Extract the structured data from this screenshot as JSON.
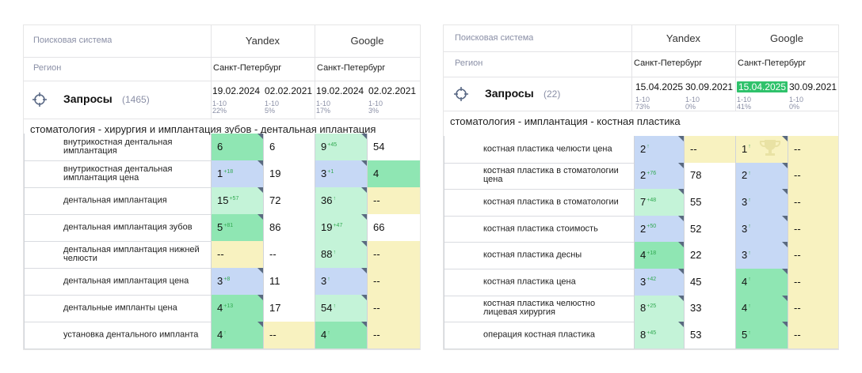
{
  "colors": {
    "green": "#8fe6b3",
    "light_green": "#c4f3d8",
    "blue": "#c6d8f5",
    "yellow": "#f8f2c0",
    "white": "#ffffff",
    "highlight": "#2fc26b"
  },
  "left": {
    "search_system_label": "Поисковая система",
    "region_label": "Регион",
    "engines": [
      "Yandex",
      "Google"
    ],
    "regions": [
      "Санкт-Петербург",
      "Санкт-Петербург"
    ],
    "queries_label": "Запросы",
    "queries_count": "(1465)",
    "dates": [
      {
        "date": "19.02.2024",
        "range": "1-10",
        "pct": "22%"
      },
      {
        "date": "02.02.2021",
        "range": "1-10",
        "pct": "5%"
      },
      {
        "date": "19.02.2024",
        "range": "1-10",
        "pct": "17%"
      },
      {
        "date": "02.02.2021",
        "range": "1-10",
        "pct": "3%"
      }
    ],
    "section_title": "стоматология - хирургия и имплантация зубов - дентальная иплантация",
    "rows": [
      {
        "kw": "внутрикостная дентальная имплантация",
        "cells": [
          {
            "v": "6",
            "s": "",
            "c": "green",
            "t": true
          },
          {
            "v": "6",
            "s": "",
            "c": "white",
            "t": false
          },
          {
            "v": "9",
            "s": "+45",
            "c": "light_green",
            "t": true
          },
          {
            "v": "54",
            "s": "",
            "c": "white",
            "t": false
          }
        ]
      },
      {
        "kw": "внутрикостная дентальная имплантация цена",
        "cells": [
          {
            "v": "1",
            "s": "+18",
            "c": "blue",
            "t": true
          },
          {
            "v": "19",
            "s": "",
            "c": "white",
            "t": false
          },
          {
            "v": "3",
            "s": "+1",
            "c": "blue",
            "t": true
          },
          {
            "v": "4",
            "s": "",
            "c": "green",
            "t": false
          }
        ]
      },
      {
        "kw": "дентальная имплантация",
        "cells": [
          {
            "v": "15",
            "s": "+57",
            "c": "light_green",
            "t": true
          },
          {
            "v": "72",
            "s": "",
            "c": "white",
            "t": false
          },
          {
            "v": "36",
            "s": "↑",
            "c": "light_green",
            "t": true
          },
          {
            "v": "--",
            "s": "",
            "c": "yellow",
            "t": false
          }
        ]
      },
      {
        "kw": "дентальная имплантация зубов",
        "cells": [
          {
            "v": "5",
            "s": "+81",
            "c": "green",
            "t": true
          },
          {
            "v": "86",
            "s": "",
            "c": "white",
            "t": false
          },
          {
            "v": "19",
            "s": "+47",
            "c": "light_green",
            "t": true
          },
          {
            "v": "66",
            "s": "",
            "c": "white",
            "t": false
          }
        ]
      },
      {
        "kw": "дентальная имплантация нижней челюсти",
        "cells": [
          {
            "v": "--",
            "s": "",
            "c": "yellow",
            "t": false
          },
          {
            "v": "--",
            "s": "",
            "c": "white",
            "t": false
          },
          {
            "v": "88",
            "s": "↑",
            "c": "light_green",
            "t": true
          },
          {
            "v": "--",
            "s": "",
            "c": "yellow",
            "t": false
          }
        ]
      },
      {
        "kw": "дентальная имплантация цена",
        "cells": [
          {
            "v": "3",
            "s": "+8",
            "c": "blue",
            "t": true
          },
          {
            "v": "11",
            "s": "",
            "c": "white",
            "t": false
          },
          {
            "v": "3",
            "s": "↑",
            "c": "blue",
            "t": true
          },
          {
            "v": "--",
            "s": "",
            "c": "yellow",
            "t": false
          }
        ]
      },
      {
        "kw": "дентальные импланты цена",
        "cells": [
          {
            "v": "4",
            "s": "+13",
            "c": "green",
            "t": true
          },
          {
            "v": "17",
            "s": "",
            "c": "white",
            "t": false
          },
          {
            "v": "54",
            "s": "↑",
            "c": "light_green",
            "t": true
          },
          {
            "v": "--",
            "s": "",
            "c": "yellow",
            "t": false
          }
        ]
      },
      {
        "kw": "установка дентального импланта",
        "cells": [
          {
            "v": "4",
            "s": "↑",
            "c": "green",
            "t": true
          },
          {
            "v": "--",
            "s": "",
            "c": "yellow",
            "t": false
          },
          {
            "v": "4",
            "s": "↑",
            "c": "green",
            "t": true
          },
          {
            "v": "--",
            "s": "",
            "c": "yellow",
            "t": false
          }
        ]
      }
    ]
  },
  "right": {
    "search_system_label": "Поисковая система",
    "region_label": "Регион",
    "engines": [
      "Yandex",
      "Google"
    ],
    "regions": [
      "Санкт-Петербург",
      "Санкт-Петербург"
    ],
    "queries_label": "Запросы",
    "queries_count": "(22)",
    "dates": [
      {
        "date": "15.04.2025",
        "range": "1-10",
        "pct": "73%",
        "hl": false
      },
      {
        "date": "30.09.2021",
        "range": "1-10",
        "pct": "0%",
        "hl": false
      },
      {
        "date": "15.04.2025",
        "range": "1-10",
        "pct": "41%",
        "hl": true
      },
      {
        "date": "30.09.2021",
        "range": "1-10",
        "pct": "0%",
        "hl": false
      }
    ],
    "section_title": "стоматология - имплантация - костная пластика",
    "rows": [
      {
        "kw": "костная пластика челюсти цена",
        "cells": [
          {
            "v": "2",
            "s": "↑",
            "c": "blue",
            "t": true
          },
          {
            "v": "--",
            "s": "",
            "c": "yellow",
            "t": false
          },
          {
            "v": "1",
            "s": "↑",
            "c": "yellow",
            "t": true,
            "trophy": true
          },
          {
            "v": "--",
            "s": "",
            "c": "yellow",
            "t": false
          }
        ]
      },
      {
        "kw": "костная пластика в стоматологии цена",
        "cells": [
          {
            "v": "2",
            "s": "+76",
            "c": "blue",
            "t": true
          },
          {
            "v": "78",
            "s": "",
            "c": "white",
            "t": false
          },
          {
            "v": "2",
            "s": "↑",
            "c": "blue",
            "t": true
          },
          {
            "v": "--",
            "s": "",
            "c": "yellow",
            "t": false
          }
        ]
      },
      {
        "kw": "костная пластика в стоматологии",
        "cells": [
          {
            "v": "7",
            "s": "+48",
            "c": "light_green",
            "t": true
          },
          {
            "v": "55",
            "s": "",
            "c": "white",
            "t": false
          },
          {
            "v": "3",
            "s": "↑",
            "c": "blue",
            "t": true
          },
          {
            "v": "--",
            "s": "",
            "c": "yellow",
            "t": false
          }
        ]
      },
      {
        "kw": "костная пластика стоимость",
        "cells": [
          {
            "v": "2",
            "s": "+50",
            "c": "blue",
            "t": true
          },
          {
            "v": "52",
            "s": "",
            "c": "white",
            "t": false
          },
          {
            "v": "3",
            "s": "↑",
            "c": "blue",
            "t": true
          },
          {
            "v": "--",
            "s": "",
            "c": "yellow",
            "t": false
          }
        ]
      },
      {
        "kw": "костная пластика десны",
        "cells": [
          {
            "v": "4",
            "s": "+18",
            "c": "green",
            "t": true
          },
          {
            "v": "22",
            "s": "",
            "c": "white",
            "t": false
          },
          {
            "v": "3",
            "s": "↑",
            "c": "blue",
            "t": true
          },
          {
            "v": "--",
            "s": "",
            "c": "yellow",
            "t": false
          }
        ]
      },
      {
        "kw": "костная пластика цена",
        "cells": [
          {
            "v": "3",
            "s": "+42",
            "c": "blue",
            "t": true
          },
          {
            "v": "45",
            "s": "",
            "c": "white",
            "t": false
          },
          {
            "v": "4",
            "s": "↑",
            "c": "green",
            "t": true
          },
          {
            "v": "--",
            "s": "",
            "c": "yellow",
            "t": false
          }
        ]
      },
      {
        "kw": "костная пластика челюстно лицевая хирургия",
        "cells": [
          {
            "v": "8",
            "s": "+25",
            "c": "light_green",
            "t": true
          },
          {
            "v": "33",
            "s": "",
            "c": "white",
            "t": false
          },
          {
            "v": "4",
            "s": "↑",
            "c": "green",
            "t": true
          },
          {
            "v": "--",
            "s": "",
            "c": "yellow",
            "t": false
          }
        ]
      },
      {
        "kw": "операция костная пластика",
        "cells": [
          {
            "v": "8",
            "s": "+45",
            "c": "light_green",
            "t": true
          },
          {
            "v": "53",
            "s": "",
            "c": "white",
            "t": false
          },
          {
            "v": "5",
            "s": "↑",
            "c": "green",
            "t": true
          },
          {
            "v": "--",
            "s": "",
            "c": "yellow",
            "t": false
          }
        ]
      }
    ]
  }
}
